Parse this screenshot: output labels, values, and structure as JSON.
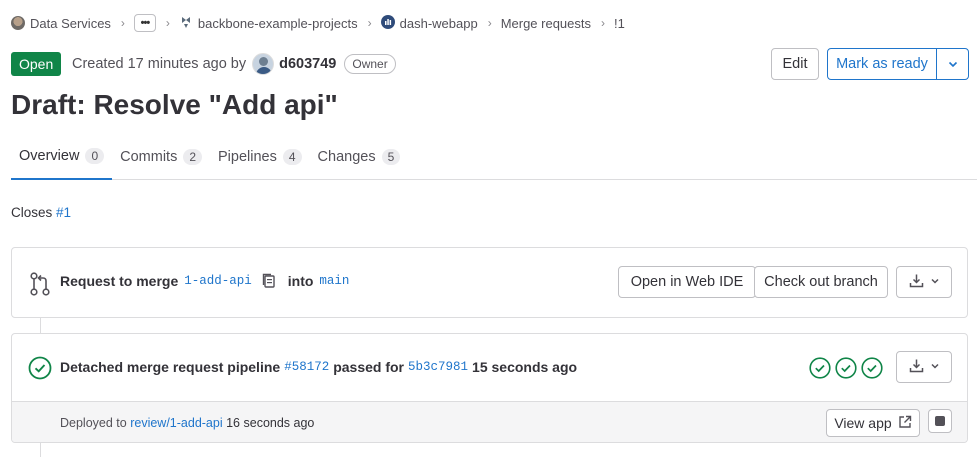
{
  "breadcrumb": {
    "items": [
      {
        "label": "Data Services"
      },
      {
        "label": "•••"
      },
      {
        "label": "backbone-example-projects"
      },
      {
        "label": "dash-webapp"
      },
      {
        "label": "Merge requests"
      },
      {
        "label": "!1"
      }
    ]
  },
  "header": {
    "status": "Open",
    "created_text": "Created 17 minutes ago by",
    "author": "d603749",
    "role": "Owner",
    "edit_label": "Edit",
    "mark_ready_label": "Mark as ready"
  },
  "title": "Draft: Resolve \"Add api\"",
  "tabs": [
    {
      "label": "Overview",
      "count": "0"
    },
    {
      "label": "Commits",
      "count": "2"
    },
    {
      "label": "Pipelines",
      "count": "4"
    },
    {
      "label": "Changes",
      "count": "5"
    }
  ],
  "closes": {
    "label": "Closes",
    "issue": "#1"
  },
  "merge_widget": {
    "request_label": "Request to merge",
    "source_branch": "1-add-api",
    "into_label": "into",
    "target_branch": "main",
    "web_ide_label": "Open in Web IDE",
    "checkout_label": "Check out branch"
  },
  "pipeline": {
    "label": "Detached merge request pipeline",
    "id": "#58172",
    "passed_label": "passed for",
    "commit": "5b3c7981",
    "time": "15 seconds ago",
    "stages": [
      "passed",
      "passed",
      "passed"
    ],
    "status_color": "#108548"
  },
  "deployment": {
    "prefix": "Deployed to",
    "environment": "review/1-add-api",
    "time": "16 seconds ago",
    "view_app_label": "View app"
  },
  "colors": {
    "accent": "#1f75cb",
    "success": "#108548"
  }
}
